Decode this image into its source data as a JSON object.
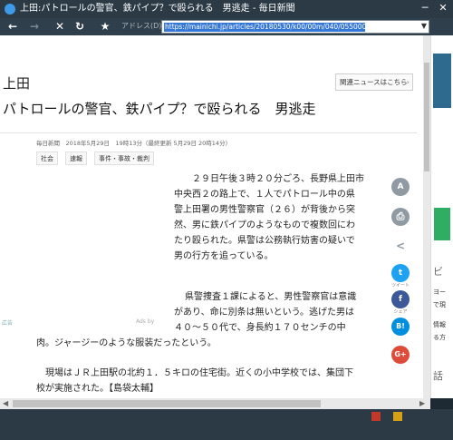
{
  "window": {
    "title": "上田:パトロールの警官、鉄パイプ？で殴られる　男逃走 - 毎日新聞",
    "minimize": "─",
    "close": "✕"
  },
  "toolbar": {
    "back": "←",
    "forward": "→",
    "stop": "✕",
    "refresh": "↻",
    "favorite": "★",
    "address_label": "アドレス(D)",
    "url": "https://mainichi.jp/articles/20180530/k00/00m/040/055000c",
    "dropdown": "▼"
  },
  "article": {
    "prefecture": "上田",
    "headline": "パトロールの警官、鉄パイプ？で殴られる　男逃走",
    "related_button": "関連ニュースはこちら",
    "related_arrow": "›",
    "meta": "毎日新聞　2018年5月29日　19時13分（最終更新 5月29日 20時14分）",
    "tags": [
      "社会",
      "速報",
      "事件・事故・裁判"
    ],
    "para1": [
      "２９日午後３時２０分ごろ、長野県上田市",
      "中央西２の路上で、１人でパトロール中の県",
      "警上田署の男性警察官（２６）が背後から突",
      "然、男に鉄パイプのようなもので複数回にわ",
      "たり殴られた。県警は公務執行妨害の疑いで",
      "男の行方を追っている。"
    ],
    "para2": [
      "県警捜査１課によると、男性警察官は意識",
      "があり、命に別条は無いという。逃げた男は",
      "４０～５０代で、身長約１７０センチの中"
    ],
    "para2_tail": "肉。ジャージーのような服装だったという。",
    "para3": [
      "現場はＪＲ上田駅の北約１．５キロの住宅街。近くの小中学校では、集団下",
      "校が実施された。【島袋太輔】"
    ],
    "ad_left": "広告",
    "ad_right": "Ads by"
  },
  "side_share": {
    "font_size": "A",
    "print": "⎙",
    "share": "<",
    "twitter": "t",
    "twitter_caption": "ツイート",
    "facebook": "f",
    "facebook_caption": "シェア",
    "hatena": "B!",
    "google": "G+"
  },
  "right_panel": {
    "text1": "ビ",
    "text2": "ヨー",
    "text3": "で現",
    "text4": "情報",
    "text5": "る方",
    "text6": "話"
  },
  "colors": {
    "twitter": "#1da1f2",
    "facebook": "#3b5998",
    "hatena": "#008fde",
    "google": "#dd4b39",
    "gray_icon": "#8f9aa2"
  }
}
